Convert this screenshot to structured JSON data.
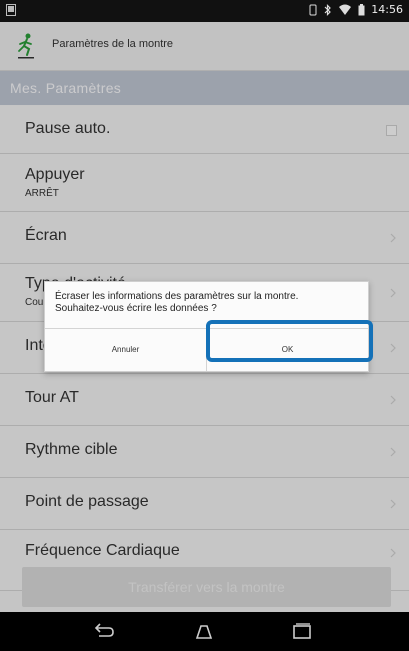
{
  "status_bar": {
    "time": "14:56",
    "icons": [
      "vibrate-icon",
      "bluetooth-icon",
      "wifi-icon",
      "battery-icon"
    ]
  },
  "app_bar": {
    "title": "Paramètres de la montre",
    "logo_icon": "runner-icon"
  },
  "section": {
    "title": "Mes. Paramètres"
  },
  "list": {
    "items": [
      {
        "label": "Pause auto.",
        "control": "checkbox",
        "checked": false
      },
      {
        "label": "Appuyer",
        "value": "ARRÊT"
      },
      {
        "label": "Écran",
        "control": "chevron-right-icon"
      },
      {
        "label": "Type d'activité",
        "value": "Course",
        "control": "chevron-right-icon"
      },
      {
        "label": "Intervalle",
        "control": "chevron-right-icon"
      },
      {
        "label": "Tour AT",
        "control": "chevron-right-icon"
      },
      {
        "label": "Rythme cible",
        "control": "chevron-right-icon"
      },
      {
        "label": "Point de passage",
        "control": "chevron-right-icon"
      },
      {
        "label": "Fréquence Cardiaque",
        "control": "chevron-right-icon"
      }
    ]
  },
  "transfer_button": {
    "label": "Transférer vers la montre"
  },
  "dialog": {
    "message_line1": "Écraser les informations des paramètres sur la montre.",
    "message_line2": "Souhaitez-vous écrire les données ?",
    "cancel_label": "Annuler",
    "ok_label": "OK"
  },
  "nav_bar": {
    "icons": [
      "back-icon",
      "home-icon",
      "recents-icon"
    ]
  },
  "colors": {
    "highlight": "#1471b8",
    "section_header": "#bfc6d2"
  }
}
